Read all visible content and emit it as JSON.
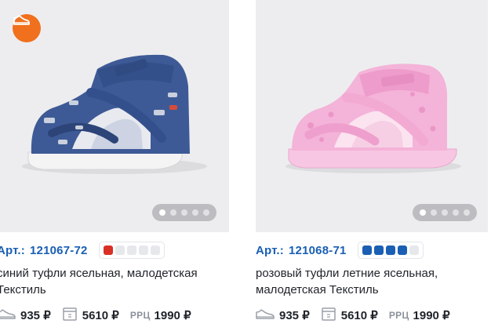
{
  "products": [
    {
      "article_label": "Арт.:",
      "article": "121067-72",
      "stock_level": 1,
      "stock_color": "#d93025",
      "title": "синий туфли ясельная, малодетская Текстиль",
      "price": "935 ₽",
      "box_price": "5610 ₽",
      "rrc_label": "РРЦ",
      "rrc_price": "1990 ₽",
      "has_badge": true,
      "badge_icon": "shoe-icon",
      "image_colors": {
        "main": "#3e5a96",
        "sole": "#f4f4f4"
      },
      "gallery_slides": 5,
      "gallery_active": 1
    },
    {
      "article_label": "Арт.:",
      "article": "121068-71",
      "stock_level": 4,
      "stock_color": "#1a5fb4",
      "title": "розовый туфли летние ясельная, малодетская Текстиль",
      "price": "935 ₽",
      "box_price": "5610 ₽",
      "rrc_label": "РРЦ",
      "rrc_price": "1990 ₽",
      "has_badge": false,
      "image_colors": {
        "main": "#f4b3d8",
        "sole": "#f7c6e2"
      },
      "gallery_slides": 5,
      "gallery_active": 1
    }
  ],
  "icons": {
    "price": "sneaker-icon",
    "box": "box-icon"
  }
}
